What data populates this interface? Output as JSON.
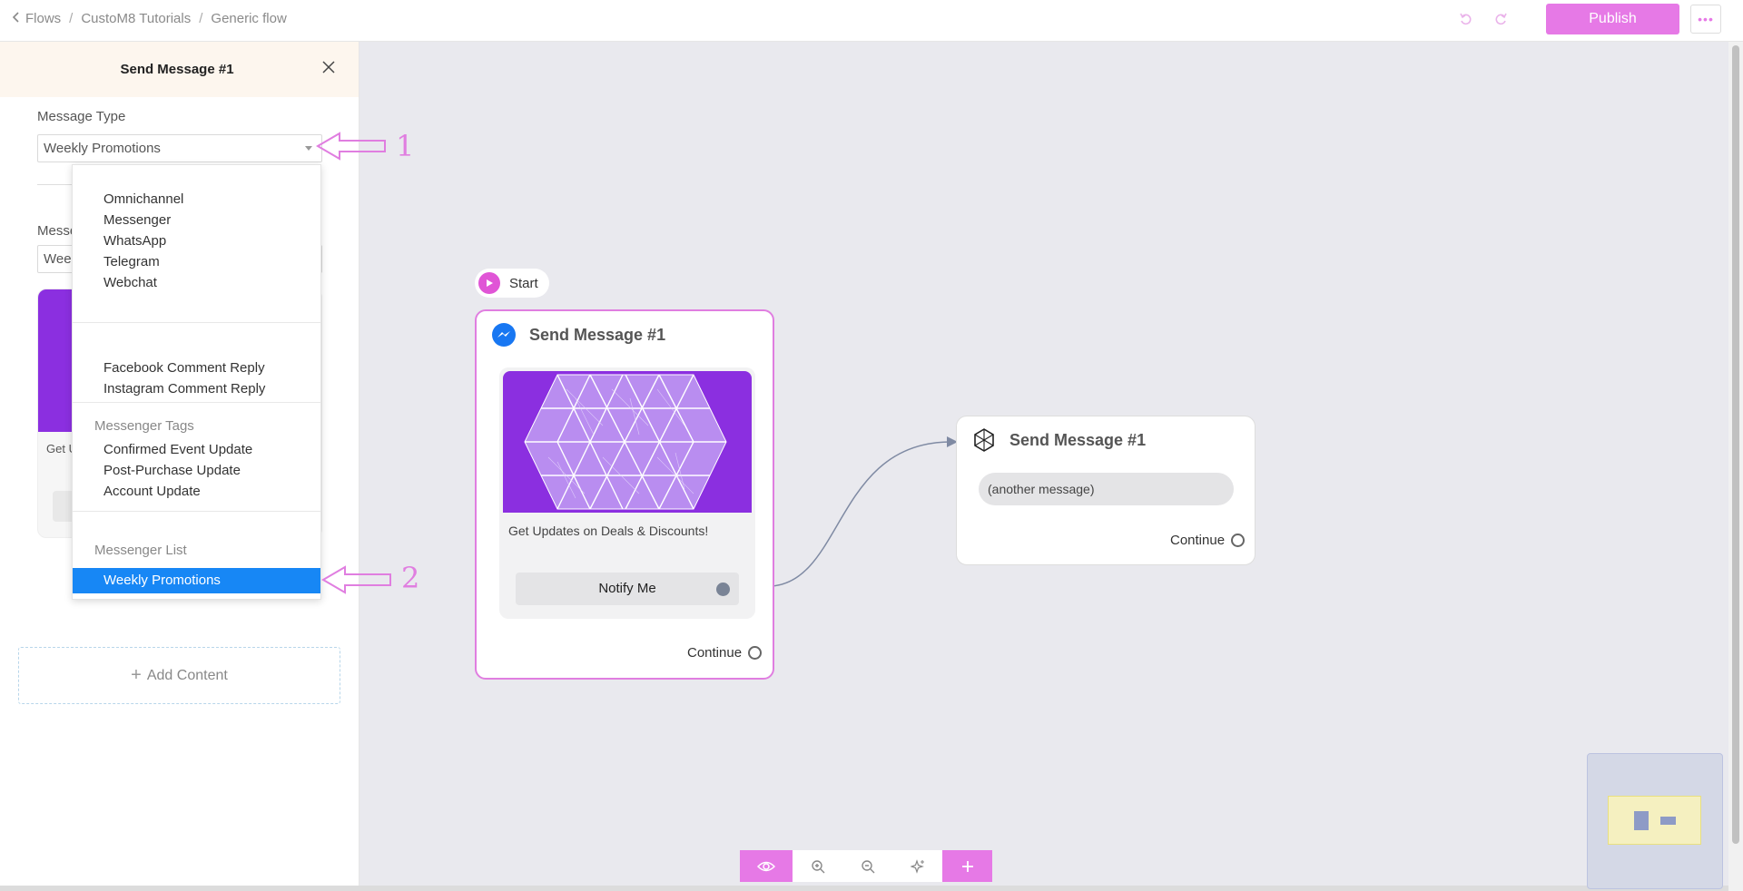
{
  "breadcrumb": [
    "Flows",
    "CustoM8 Tutorials",
    "Generic flow"
  ],
  "toolbar": {
    "publish_label": "Publish",
    "more_label": "•••"
  },
  "panel": {
    "title": "Send Message #1",
    "message_type_label": "Message Type",
    "message_type_value": "Weekly Promotions",
    "behind_label": "Messe",
    "behind_value": "Weel",
    "behind_card_text": "Get U",
    "add_content_label": "Add Content"
  },
  "dropdown": {
    "channels": [
      "Omnichannel",
      "Messenger",
      "WhatsApp",
      "Telegram",
      "Webchat"
    ],
    "comment_replies": [
      "Facebook Comment Reply",
      "Instagram Comment Reply"
    ],
    "tags_header": "Messenger Tags",
    "tags": [
      "Confirmed Event Update",
      "Post-Purchase Update",
      "Account Update"
    ],
    "list_header": "Messenger List",
    "list_items": [
      "Weekly Promotions"
    ]
  },
  "annotations": [
    "1",
    "2"
  ],
  "canvas": {
    "start_label": "Start",
    "node1": {
      "title": "Send Message #1",
      "card_text": "Get Updates on Deals & Discounts!",
      "button_label": "Notify Me",
      "continue_label": "Continue"
    },
    "node2": {
      "title": "Send Message #1",
      "message_placeholder": "(another message)",
      "continue_label": "Continue"
    }
  },
  "colors": {
    "accent": "#e679e6",
    "selected": "#1787f5",
    "purple_image": "#8b2fe0",
    "canvas_bg": "#e9e9ee"
  }
}
